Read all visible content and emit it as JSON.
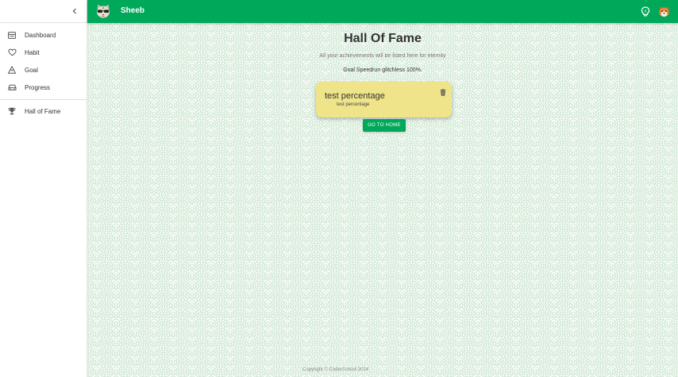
{
  "topbar": {
    "app_name": "Sheeb",
    "brand_icon": "cat-sunglasses-icon",
    "bulb_icon": "lightbulb-icon",
    "avatar_icon": "shiba-avatar-icon",
    "color": "#00a85a"
  },
  "sidebar": {
    "collapse_icon": "chevron-left-icon",
    "items": [
      {
        "label": "Dashboard",
        "icon": "dashboard-icon"
      },
      {
        "label": "Habit",
        "icon": "heart-icon"
      },
      {
        "label": "Goal",
        "icon": "mountain-icon"
      },
      {
        "label": "Progress",
        "icon": "car-icon"
      }
    ],
    "bottom_items": [
      {
        "label": "Hall of Fame",
        "icon": "trophy-icon"
      }
    ]
  },
  "main": {
    "title": "Hall Of Fame",
    "subtitle": "All your achievements will be listed here for eternity",
    "status": "Goal Speedrun glitchless 100%.",
    "cards": [
      {
        "title": "test percentage",
        "description": "test percentage",
        "color": "#efe48a",
        "delete_icon": "trash-icon"
      }
    ],
    "home_button": "GO TO HOME"
  },
  "footer": {
    "text": "Copyright © CoderSchool 2024"
  }
}
